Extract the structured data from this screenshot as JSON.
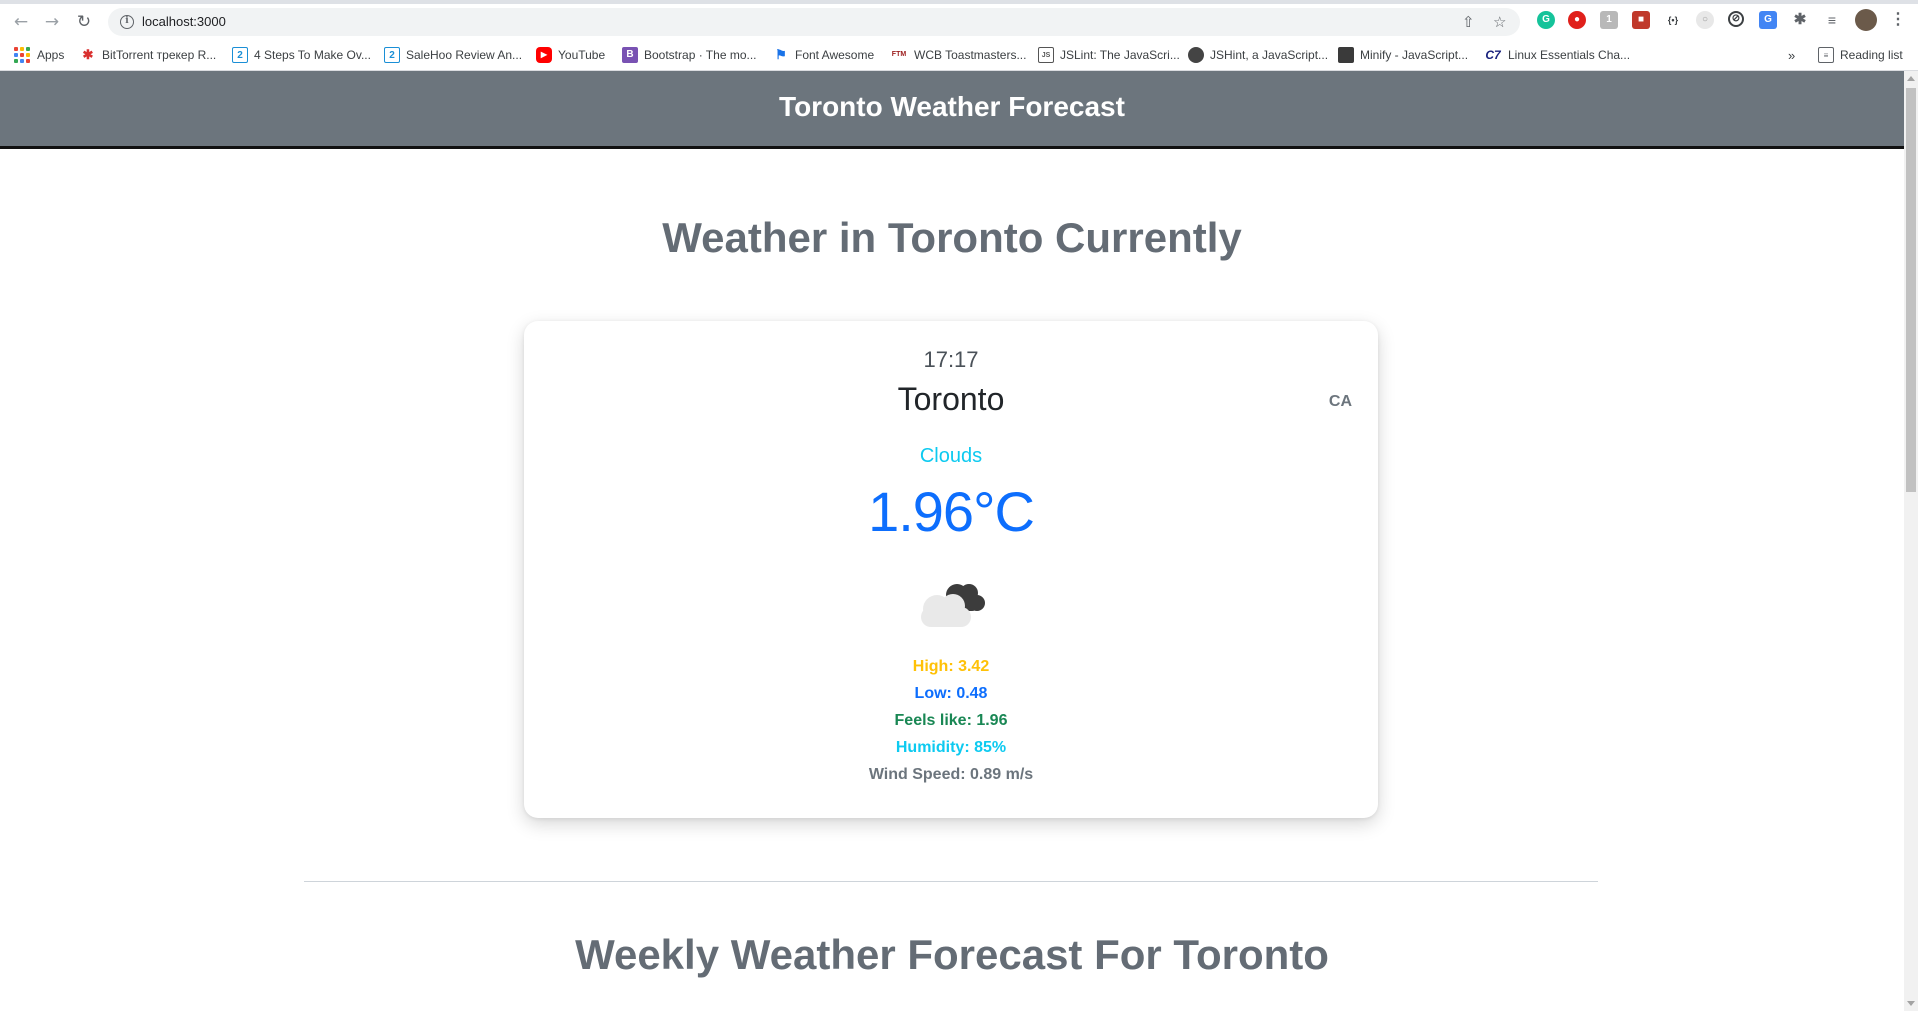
{
  "browser": {
    "url": "localhost:3000",
    "reading_list_label": "Reading list",
    "more_bookmarks": "»",
    "bookmarks": [
      {
        "label": "Apps",
        "icon": "apps-grid-icon"
      },
      {
        "label": "BitTorrent трекер R...",
        "icon": "bittorrent-icon"
      },
      {
        "label": "4 Steps To Make Ov...",
        "icon": "bookmark-2-icon"
      },
      {
        "label": "SaleHoo Review An...",
        "icon": "bookmark-2-icon"
      },
      {
        "label": "YouTube",
        "icon": "youtube-icon"
      },
      {
        "label": "Bootstrap · The mo...",
        "icon": "bootstrap-icon"
      },
      {
        "label": "Font Awesome",
        "icon": "flag-icon"
      },
      {
        "label": "WCB Toastmasters...",
        "icon": "ftm-icon"
      },
      {
        "label": "JSLint: The JavaScri...",
        "icon": "jslint-icon"
      },
      {
        "label": "JSHint, a JavaScript...",
        "icon": "jshint-icon"
      },
      {
        "label": "Minify - JavaScript...",
        "icon": "minify-icon"
      },
      {
        "label": "Linux Essentials Cha...",
        "icon": "c7-icon"
      }
    ]
  },
  "header": {
    "title": "Toronto Weather Forecast"
  },
  "current": {
    "heading": "Weather in Toronto Currently",
    "time": "17:17",
    "city": "Toronto",
    "country": "CA",
    "description": "Clouds",
    "temperature": "1.96°C",
    "icon": "broken-clouds-icon",
    "high": "High: 3.42",
    "low": "Low: 0.48",
    "feels_like": "Feels like: 1.96",
    "humidity": "Humidity: 85%",
    "wind": "Wind Speed: 0.89 m/s"
  },
  "weekly": {
    "heading": "Weekly Weather Forecast For Toronto"
  },
  "colors": {
    "navbar": "#6c757d",
    "info": "#0dcaf0",
    "primary": "#0d6efd",
    "warning": "#ffc107",
    "success": "#198754",
    "secondary": "#6c757d"
  }
}
